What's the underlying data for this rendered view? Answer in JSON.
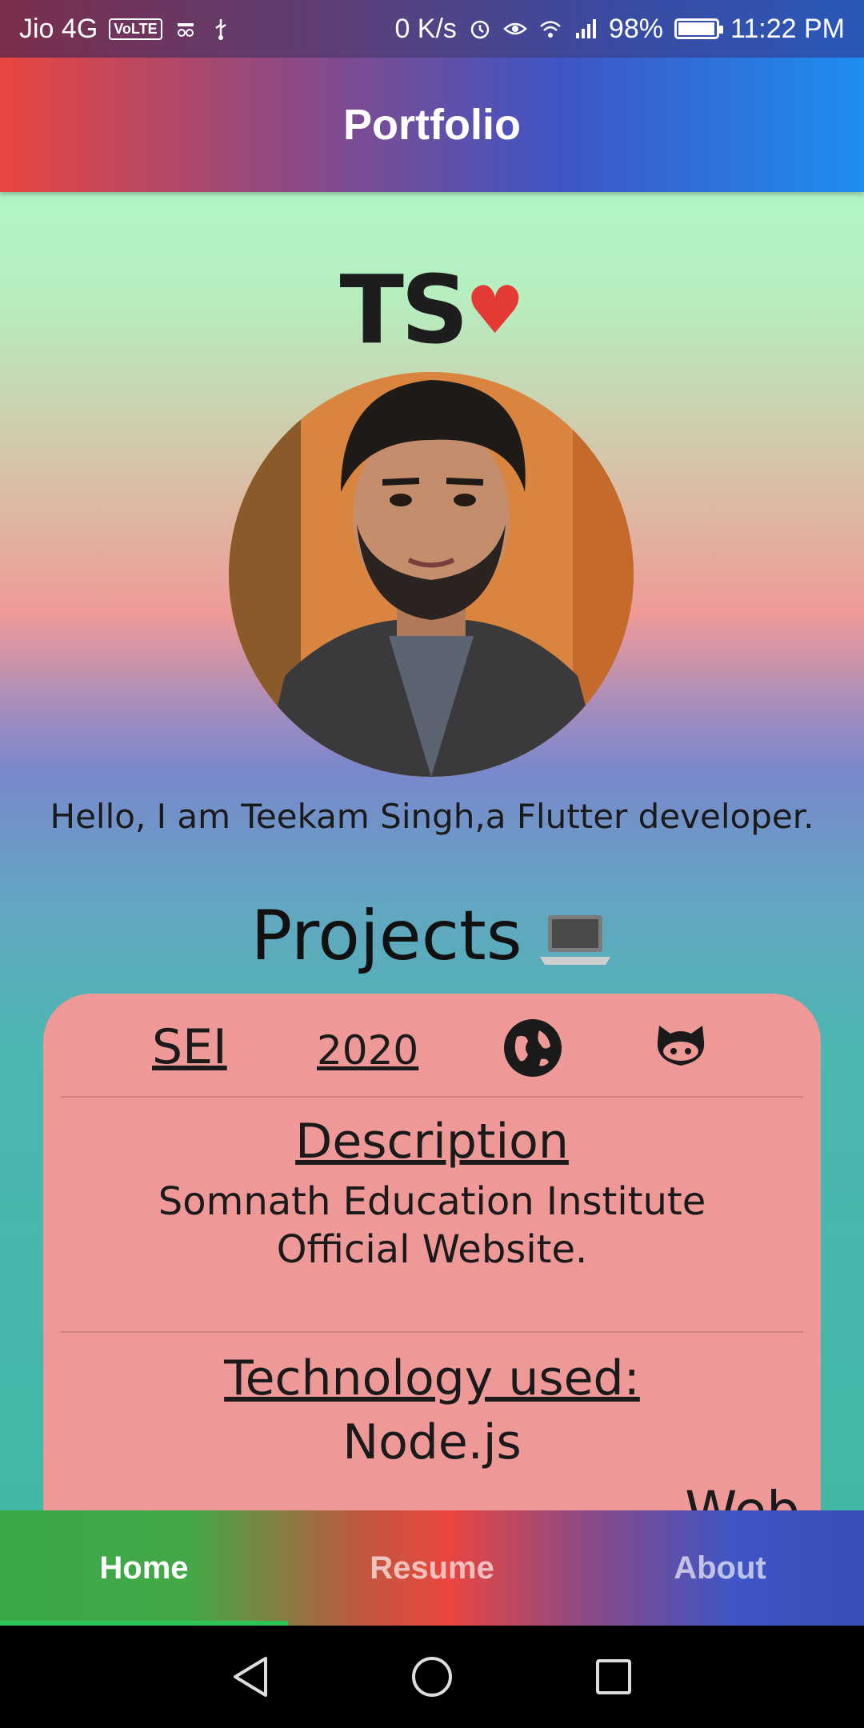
{
  "status_bar": {
    "carrier": "Jio 4G",
    "volte": "VoLTE",
    "speed": "0 K/s",
    "battery": "98%",
    "battery_level": 0.98,
    "time": "11:22 PM"
  },
  "app_bar": {
    "title": "Portfolio"
  },
  "profile": {
    "logo_text": "TS",
    "logo_heart": "♥",
    "intro": "Hello, I am Teekam Singh,a Flutter developer."
  },
  "projects": {
    "heading": "Projects",
    "heading_icon": "laptop-icon",
    "items": [
      {
        "name": "SEI",
        "year": "2020",
        "website_icon": "globe-icon",
        "repo_icon": "github-icon",
        "description_title": "Description",
        "description_line1": "Somnath Education Institute",
        "description_line2": "Official Website.",
        "technology_title": "Technology used:",
        "technology": "Node.js",
        "extra": "Web"
      }
    ]
  },
  "bottom_nav": {
    "items": [
      {
        "label": "Home",
        "active": true
      },
      {
        "label": "Resume",
        "active": false
      },
      {
        "label": "About",
        "active": false
      }
    ]
  },
  "colors": {
    "card_bg": "#ee9898",
    "heart": "#e53935",
    "active_indicator": "#2dc45a"
  }
}
